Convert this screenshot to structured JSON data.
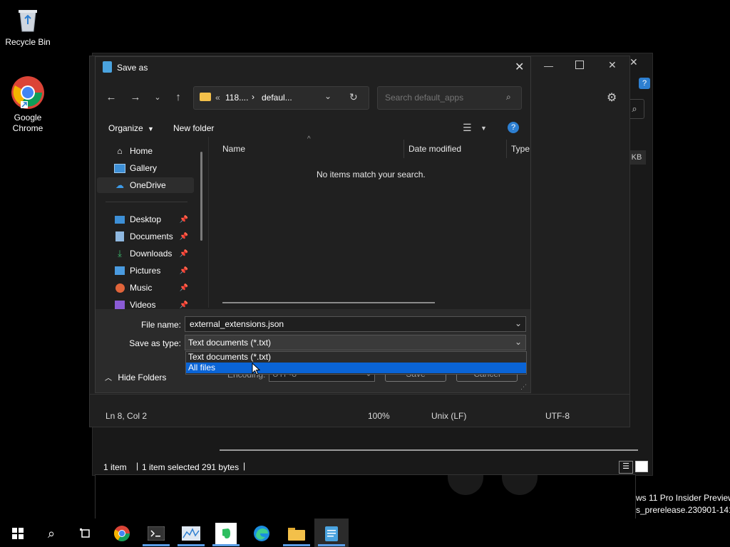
{
  "desktop": {
    "icons": [
      {
        "label_line1": "Recycle Bin",
        "label_line2": ""
      },
      {
        "label_line1": "Google",
        "label_line2": "Chrome"
      }
    ],
    "watermark": {
      "line1": "ws 11 Pro Insider Preview",
      "line2": "s_prerelease.230901-1416"
    }
  },
  "explorer_bg": {
    "size_label": "KB",
    "status_items": "1 item",
    "status_selected": "1 item selected  291 bytes",
    "status_sep": "|"
  },
  "notepad_bg": {
    "status": {
      "position": "Ln 8, Col 2",
      "zoom": "100%",
      "line_ending": "Unix (LF)",
      "encoding": "UTF-8"
    }
  },
  "dialog": {
    "title": "Save as",
    "breadcrumb": {
      "prefix": "«",
      "segment1": "118....",
      "separator": "›",
      "segment2": "defaul..."
    },
    "search": {
      "placeholder": "Search default_apps"
    },
    "toolbar": {
      "organize": "Organize",
      "new_folder": "New folder"
    },
    "nav": [
      {
        "label": "Home",
        "icon": "home-icon"
      },
      {
        "label": "Gallery",
        "icon": "gallery-icon"
      },
      {
        "label": "OneDrive",
        "icon": "onedrive-icon"
      },
      {
        "label": "Desktop",
        "icon": "desktop-icon"
      },
      {
        "label": "Documents",
        "icon": "documents-icon"
      },
      {
        "label": "Downloads",
        "icon": "downloads-icon"
      },
      {
        "label": "Pictures",
        "icon": "pictures-icon"
      },
      {
        "label": "Music",
        "icon": "music-icon"
      },
      {
        "label": "Videos",
        "icon": "videos-icon"
      }
    ],
    "columns": {
      "name": "Name",
      "date_modified": "Date modified",
      "type": "Type"
    },
    "empty_message": "No items match your search.",
    "file_name_label": "File name:",
    "file_name_value": "external_extensions.json",
    "save_as_type_label": "Save as type:",
    "save_as_type_value": "Text documents (*.txt)",
    "type_options": [
      "Text documents (*.txt)",
      "All files"
    ],
    "encoding_label": "Encoding:",
    "encoding_value": "UTF-8",
    "save_label": "Save",
    "cancel_label": "Cancel",
    "hide_folders": "Hide Folders"
  },
  "colors": {
    "accent": "#0067c0",
    "selection": "#0a64d6",
    "folder": "#f3c04a"
  }
}
